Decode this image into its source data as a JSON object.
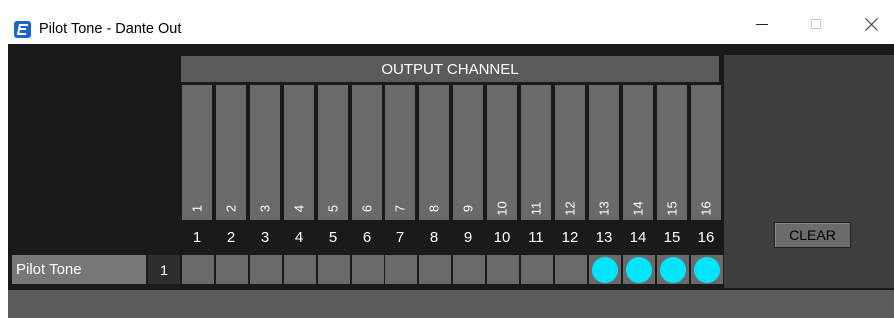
{
  "window": {
    "title": "Pilot Tone - Dante Out"
  },
  "output_header": "OUTPUT CHANNEL",
  "channels": [
    "1",
    "2",
    "3",
    "4",
    "5",
    "6",
    "7",
    "8",
    "9",
    "10",
    "11",
    "12",
    "13",
    "14",
    "15",
    "16"
  ],
  "row": {
    "label": "Pilot Tone",
    "index": "1",
    "active": [
      false,
      false,
      false,
      false,
      false,
      false,
      false,
      false,
      false,
      false,
      false,
      false,
      true,
      true,
      true,
      true
    ]
  },
  "clear_label": "CLEAR",
  "colors": {
    "active_dot": "#00e5ff",
    "panel_bg": "#1a1a1a"
  },
  "icons": {
    "app": "app-logo-icon",
    "minimize": "minimize-icon",
    "maximize": "maximize-icon",
    "close": "close-icon"
  }
}
